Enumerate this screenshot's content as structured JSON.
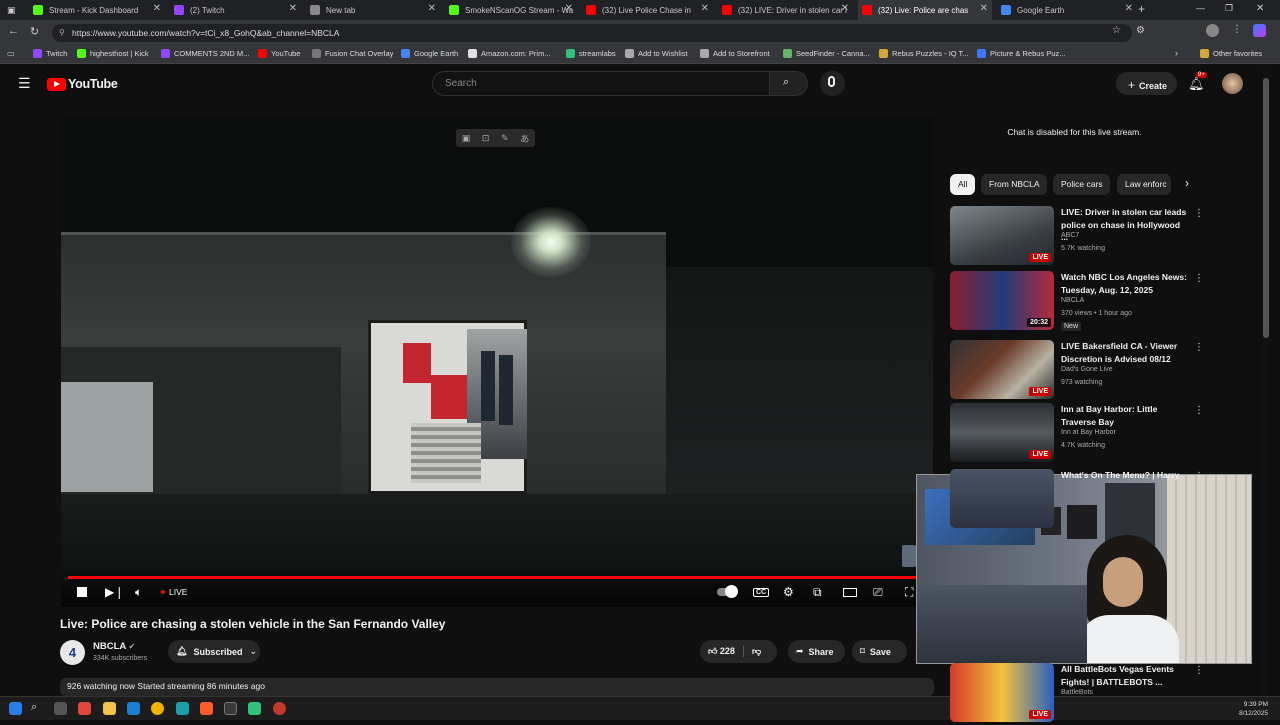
{
  "browser": {
    "tabs": [
      {
        "title": "Stream - Kick Dashboard",
        "color": "#53fc18"
      },
      {
        "title": "(2) Twitch",
        "color": "#9146ff"
      },
      {
        "title": "New tab",
        "color": "#888888"
      },
      {
        "title": "SmokeNScanOG Stream - Wa",
        "color": "#53fc18"
      },
      {
        "title": "(32) Live Police Chase in",
        "color": "#ff0000"
      },
      {
        "title": "(32) LIVE: Driver in stolen car l",
        "color": "#ff0000"
      },
      {
        "title": "(32) Live: Police are chas",
        "color": "#ff0000"
      },
      {
        "title": "Google Earth",
        "color": "#4285f4"
      }
    ],
    "url": "https://www.youtube.com/watch?v=tCi_x8_GohQ&ab_channel=NBCLA",
    "bookmarks": [
      "Twitch",
      "highesthost | Kick",
      "COMMENTS 2ND M...",
      "YouTube",
      "Fusion Chat Overlay",
      "Google Earth",
      "Amazon.com: Prim...",
      "streamlabs",
      "Add to Wishlist",
      "Add to Storefront",
      "SeedFinder - Canna...",
      "Rebus Puzzles - IQ T...",
      "Picture & Rebus Puz..."
    ],
    "other_favorites": "Other favorites"
  },
  "youtube": {
    "logo": "YouTube",
    "search_placeholder": "Search",
    "create_label": "Create",
    "notification_count": "9+"
  },
  "player": {
    "live_label": "LIVE",
    "progress_fraction": 1.0
  },
  "video": {
    "title": "Live: Police are chasing a stolen vehicle in the San Fernando Valley",
    "channel": "NBCLA",
    "subscribers": "334K subscribers",
    "subscribed_label": "Subscribed",
    "likes": "228",
    "share_label": "Share",
    "save_label": "Save",
    "description_stats": "926 watching now  Started streaming 86 minutes ago"
  },
  "sidebar": {
    "chat_disabled": "Chat is disabled for this live stream.",
    "chips": [
      "All",
      "From NBCLA",
      "Police cars",
      "Law enforc"
    ],
    "recommendations": [
      {
        "title": "LIVE: Driver in stolen car leads police on chase in Hollywood ...",
        "channel": "ABC7",
        "meta": "5.7K watching",
        "badge": "LIVE",
        "extra": ""
      },
      {
        "title": "Watch NBC Los Angeles News: Tuesday, Aug. 12, 2025",
        "channel": "NBCLA",
        "meta": "370 views • 1 hour ago",
        "badge": "20:32",
        "extra": "New"
      },
      {
        "title": "LIVE Bakersfield CA - Viewer Discretion is Advised 08/12",
        "channel": "Dad's Gone Live",
        "meta": "973 watching",
        "badge": "LIVE",
        "extra": ""
      },
      {
        "title": "Inn at Bay Harbor: Little Traverse Bay",
        "channel": "Inn at Bay Harbor",
        "meta": "4.7K watching",
        "badge": "LIVE",
        "extra": ""
      },
      {
        "title": "What's On The Menu? | Harry",
        "channel": "",
        "meta": "",
        "badge": "",
        "extra": ""
      },
      {
        "title": "All BattleBots Vegas Events Fights! | BATTLEBOTS ...",
        "channel": "BattleBots",
        "meta": "",
        "badge": "LIVE",
        "extra": ""
      }
    ]
  },
  "taskbar": {
    "time": "9:39 PM",
    "date": "8/12/2025"
  }
}
